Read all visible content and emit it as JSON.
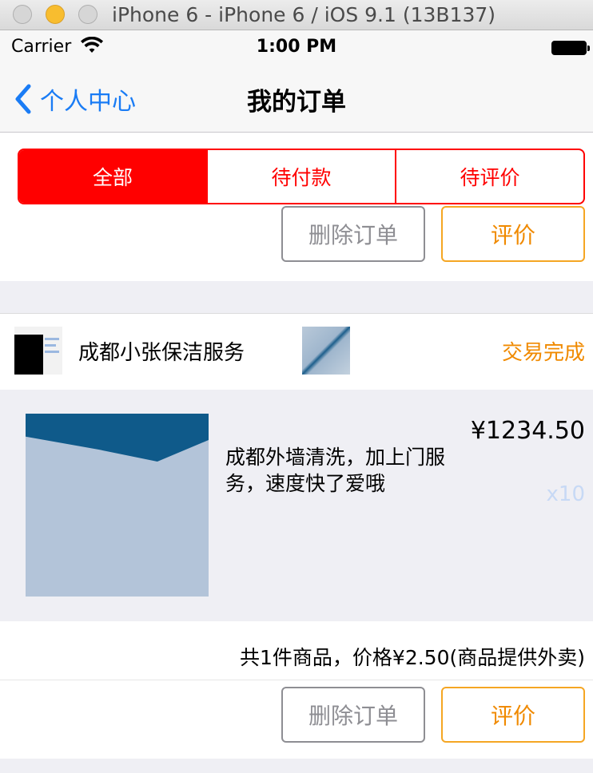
{
  "window": {
    "title": "iPhone 6 - iPhone 6 / iOS 9.1 (13B137)"
  },
  "statusbar": {
    "carrier": "Carrier",
    "time": "1:00 PM"
  },
  "navbar": {
    "back_label": "个人中心",
    "title": "我的订单"
  },
  "segments": [
    {
      "label": "全部",
      "active": true
    },
    {
      "label": "待付款",
      "active": false
    },
    {
      "label": "待评价",
      "active": false
    }
  ],
  "first_order": {
    "delete_label": "删除订单",
    "rate_label": "评价"
  },
  "order": {
    "shop_name": "成都小张保洁服务",
    "status": "交易完成",
    "product_name": "成都外墙清洗，加上门服务，速度快了爱哦",
    "price": "¥1234.50",
    "quantity": "x10",
    "summary": "共1件商品，价格¥2.50(商品提供外卖)",
    "delete_label": "删除订单",
    "rate_label": "评价"
  },
  "colors": {
    "accent": "#ff0000",
    "link": "#1a7cf5",
    "status": "#f08a00"
  }
}
